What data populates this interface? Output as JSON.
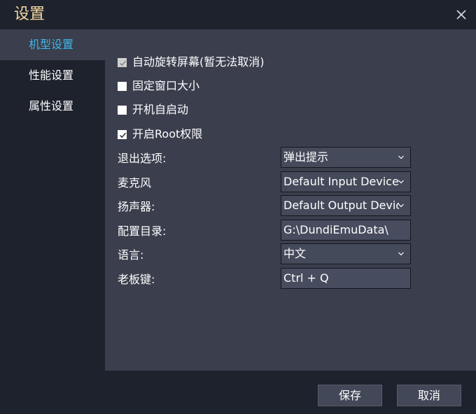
{
  "window": {
    "title": "设置",
    "close_icon": "close-icon"
  },
  "sidebar": {
    "items": [
      {
        "label": "机型设置",
        "active": true
      },
      {
        "label": "性能设置",
        "active": false
      },
      {
        "label": "属性设置",
        "active": false
      }
    ]
  },
  "options": {
    "auto_rotate": {
      "label": "自动旋转屏幕(暂无法取消)",
      "checked": true,
      "disabled": true
    },
    "fixed_window": {
      "label": "固定窗口大小",
      "checked": false
    },
    "auto_start": {
      "label": "开机自启动",
      "checked": false
    },
    "root": {
      "label": "开启Root权限",
      "checked": true
    }
  },
  "fields": {
    "exit": {
      "label": "退出选项:",
      "value": "弹出提示"
    },
    "microphone": {
      "label": "麦克风",
      "value": "Default Input Device"
    },
    "speaker": {
      "label": "扬声器:",
      "value": "Default Output Device"
    },
    "config_dir": {
      "label": "配置目录:",
      "value": "G:\\DundiEmuData\\"
    },
    "language": {
      "label": "语言:",
      "value": "中文"
    },
    "boss_key": {
      "label": "老板键:",
      "value": "Ctrl + Q"
    }
  },
  "footer": {
    "save_label": "保存",
    "cancel_label": "取消"
  },
  "colors": {
    "background": "#1e222d",
    "panel": "#3a3e4d",
    "title": "#f4d9a3",
    "active_nav": "#3fb7e8"
  }
}
